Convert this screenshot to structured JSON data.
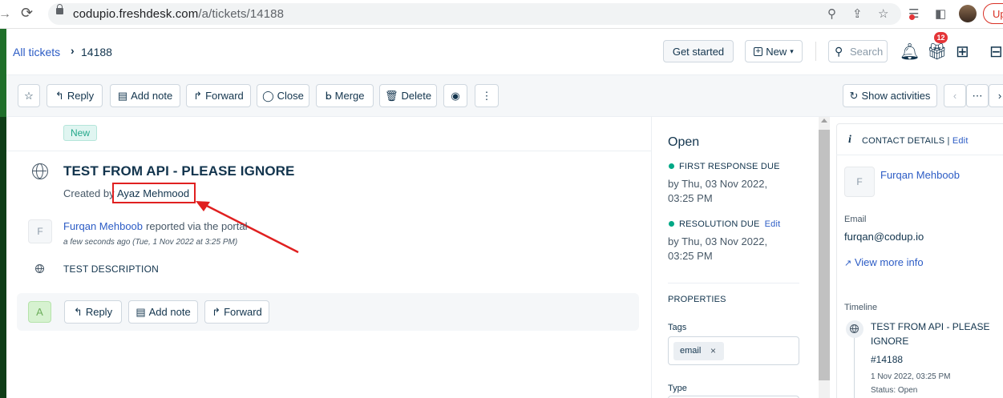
{
  "browser": {
    "url_host": "codupio.freshdesk.com",
    "url_path": "/a/tickets/14188",
    "update_label": "Up"
  },
  "header": {
    "breadcrumb_all": "All tickets",
    "breadcrumb_sep": "›",
    "ticket_id": "14188",
    "get_started": "Get started",
    "new_label": "New",
    "search_placeholder": "Search",
    "notification_count": "12"
  },
  "toolbar": {
    "reply": "Reply",
    "add_note": "Add note",
    "forward": "Forward",
    "close": "Close",
    "merge": "Merge",
    "delete": "Delete",
    "show_activities": "Show activities"
  },
  "ticket": {
    "status_badge": "New",
    "title": "TEST FROM API - PLEASE IGNORE",
    "created_by_prefix": "Created by",
    "created_by_name": "Ayaz Mehmood",
    "reporter_initial": "F",
    "reporter_name": "Furqan Mehboob",
    "reporter_text": "reported via the portal",
    "reported_time": "a few seconds ago (Tue, 1 Nov 2022 at 3:25 PM)",
    "description": "TEST DESCRIPTION",
    "agent_initial": "A",
    "reply": "Reply",
    "add_note": "Add note",
    "forward": "Forward"
  },
  "properties": {
    "status": "Open",
    "first_response_label": "FIRST RESPONSE DUE",
    "first_response_time": "by Thu, 03 Nov 2022, 03:25 PM",
    "resolution_label": "RESOLUTION DUE",
    "resolution_edit": "Edit",
    "resolution_time": "by Thu, 03 Nov 2022, 03:25 PM",
    "properties_heading": "PROPERTIES",
    "tags_label": "Tags",
    "tag": "email",
    "type_label": "Type"
  },
  "contact": {
    "heading": "CONTACT DETAILS",
    "edit": "Edit",
    "initial": "F",
    "name": "Furqan Mehboob",
    "email_label": "Email",
    "email": "furqan@codup.io",
    "view_more": "View more info",
    "timeline_label": "Timeline",
    "timeline_title": "TEST FROM API - PLEASE IGNORE",
    "timeline_id": "#14188",
    "timeline_date": "1 Nov 2022, 03:25 PM",
    "timeline_status": "Status: Open"
  },
  "colors": {
    "accent": "#2c5cc5",
    "highlight_red": "#e02020",
    "sla_green": "#00a886"
  }
}
